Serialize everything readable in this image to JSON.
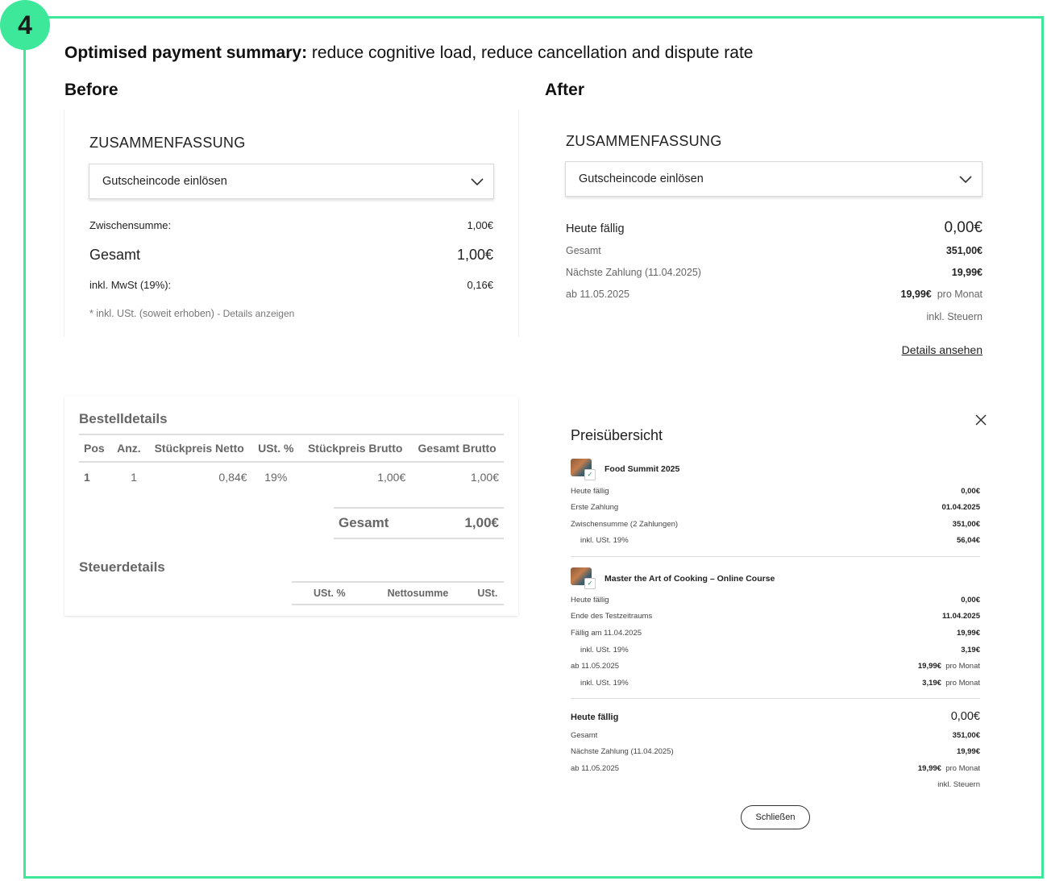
{
  "step_number": "4",
  "headline": {
    "bold": "Optimised payment summary:",
    "rest": " reduce cognitive load, reduce cancellation and dispute rate"
  },
  "before": {
    "label": "Before",
    "summary_title": "ZUSAMMENFASSUNG",
    "coupon_label": "Gutscheincode einlösen",
    "subtotal_label": "Zwischensumme:",
    "subtotal_value": "1,00€",
    "total_label": "Gesamt",
    "total_value": "1,00€",
    "vat_label": "inkl. MwSt (19%):",
    "vat_value": "0,16€",
    "footnote": "* inkl. USt. (soweit erhoben)",
    "footnote_link": " - Details anzeigen",
    "order": {
      "title": "Bestelldetails",
      "columns": [
        "Pos",
        "Anz.",
        "Stückpreis Netto",
        "USt. %",
        "Stückpreis Brutto",
        "Gesamt Brutto"
      ],
      "row": [
        "1",
        "1",
        "0,84€",
        "19%",
        "1,00€",
        "1,00€"
      ],
      "total_label": "Gesamt",
      "total_value": "1,00€",
      "tax_title": "Steuerdetails",
      "tax_columns": [
        "USt. %",
        "Nettosumme",
        "USt."
      ]
    }
  },
  "after": {
    "label": "After",
    "summary_title": "ZUSAMMENFASSUNG",
    "coupon_label": "Gutscheincode einlösen",
    "due_today_label": "Heute fällig",
    "due_today_value": "0,00€",
    "total_label": "Gesamt",
    "total_value": "351,00€",
    "next_label": "Nächste Zahlung (11.04.2025)",
    "next_value": "19,99€",
    "from_label": "ab 11.05.2025",
    "from_value": "19,99€",
    "from_unit": "pro Monat",
    "tax_note": "inkl. Steuern",
    "details_link": "Details ansehen"
  },
  "modal": {
    "title": "Preisübersicht",
    "close_label": "Schließen",
    "product1": {
      "name": "Food Summit 2025",
      "rows": [
        {
          "label": "Heute fällig",
          "value": "0,00€"
        },
        {
          "label": "Erste Zahlung",
          "value": "01.04.2025"
        },
        {
          "label": "Zwischensumme (2 Zahlungen)",
          "value": "351,00€"
        },
        {
          "label": "inkl. USt. 19%",
          "value": "56,04€"
        }
      ]
    },
    "product2": {
      "name": "Master the Art of Cooking – Online Course",
      "rows": [
        {
          "label": "Heute fällig",
          "value": "0,00€"
        },
        {
          "label": "Ende des Testzeitraums",
          "value": "11.04.2025"
        },
        {
          "label": "Fällig am 11.04.2025",
          "value": "19,99€"
        },
        {
          "label": "inkl. USt. 19%",
          "value": "3,19€"
        },
        {
          "label": "ab 11.05.2025",
          "value": "19,99€",
          "unit": "pro Monat"
        },
        {
          "label": "inkl. USt. 19%",
          "value": "3,19€",
          "unit": "pro Monat"
        }
      ]
    },
    "summary": {
      "due_today_label": "Heute fällig",
      "due_today_value": "0,00€",
      "rows": [
        {
          "label": "Gesamt",
          "value": "351,00€"
        },
        {
          "label": "Nächste Zahlung (11.04.2025)",
          "value": "19,99€"
        },
        {
          "label": "ab 11.05.2025",
          "value": "19,99€",
          "unit": "pro Monat"
        }
      ],
      "tax_note": "inkl. Steuern"
    }
  },
  "colors": {
    "accent": "#3ee89a"
  }
}
